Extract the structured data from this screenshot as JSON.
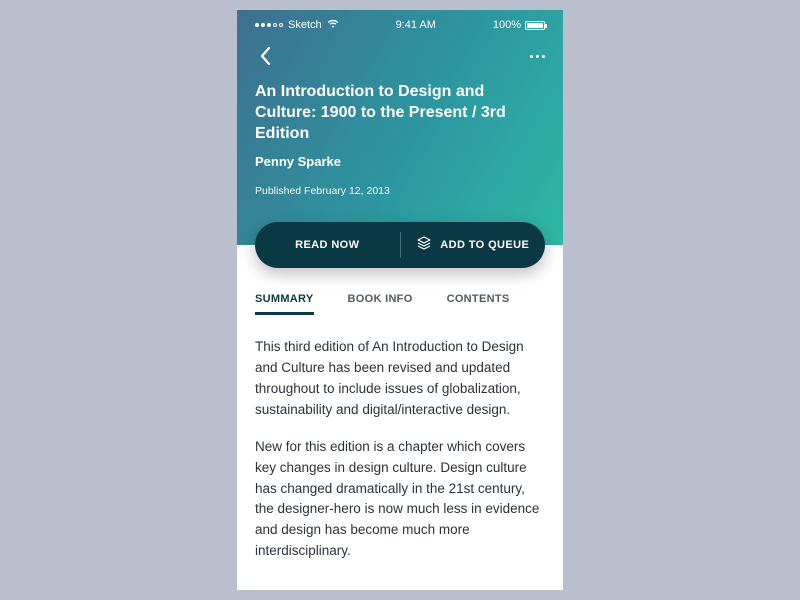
{
  "statusbar": {
    "carrier": "Sketch",
    "time": "9:41 AM",
    "battery": "100%"
  },
  "book": {
    "title": "An Introduction to Design and Culture: 1900 to the Present / 3rd Edition",
    "author": "Penny Sparke",
    "published": "Published February 12, 2013"
  },
  "actions": {
    "read": "READ NOW",
    "queue": "ADD TO QUEUE"
  },
  "tabs": {
    "summary": "SUMMARY",
    "info": "BOOK INFO",
    "contents": "CONTENTS"
  },
  "summary": {
    "p1": "This third edition of An Introduction to Design and Culture has been revised and updated throughout to include issues of globalization, sustainability and digital/interactive design.",
    "p2": "New for this edition is a chapter which covers key changes in design culture. Design culture has changed dramatically in the 21st century, the designer-hero is now much less in evidence and design has become much more interdisciplinary."
  }
}
